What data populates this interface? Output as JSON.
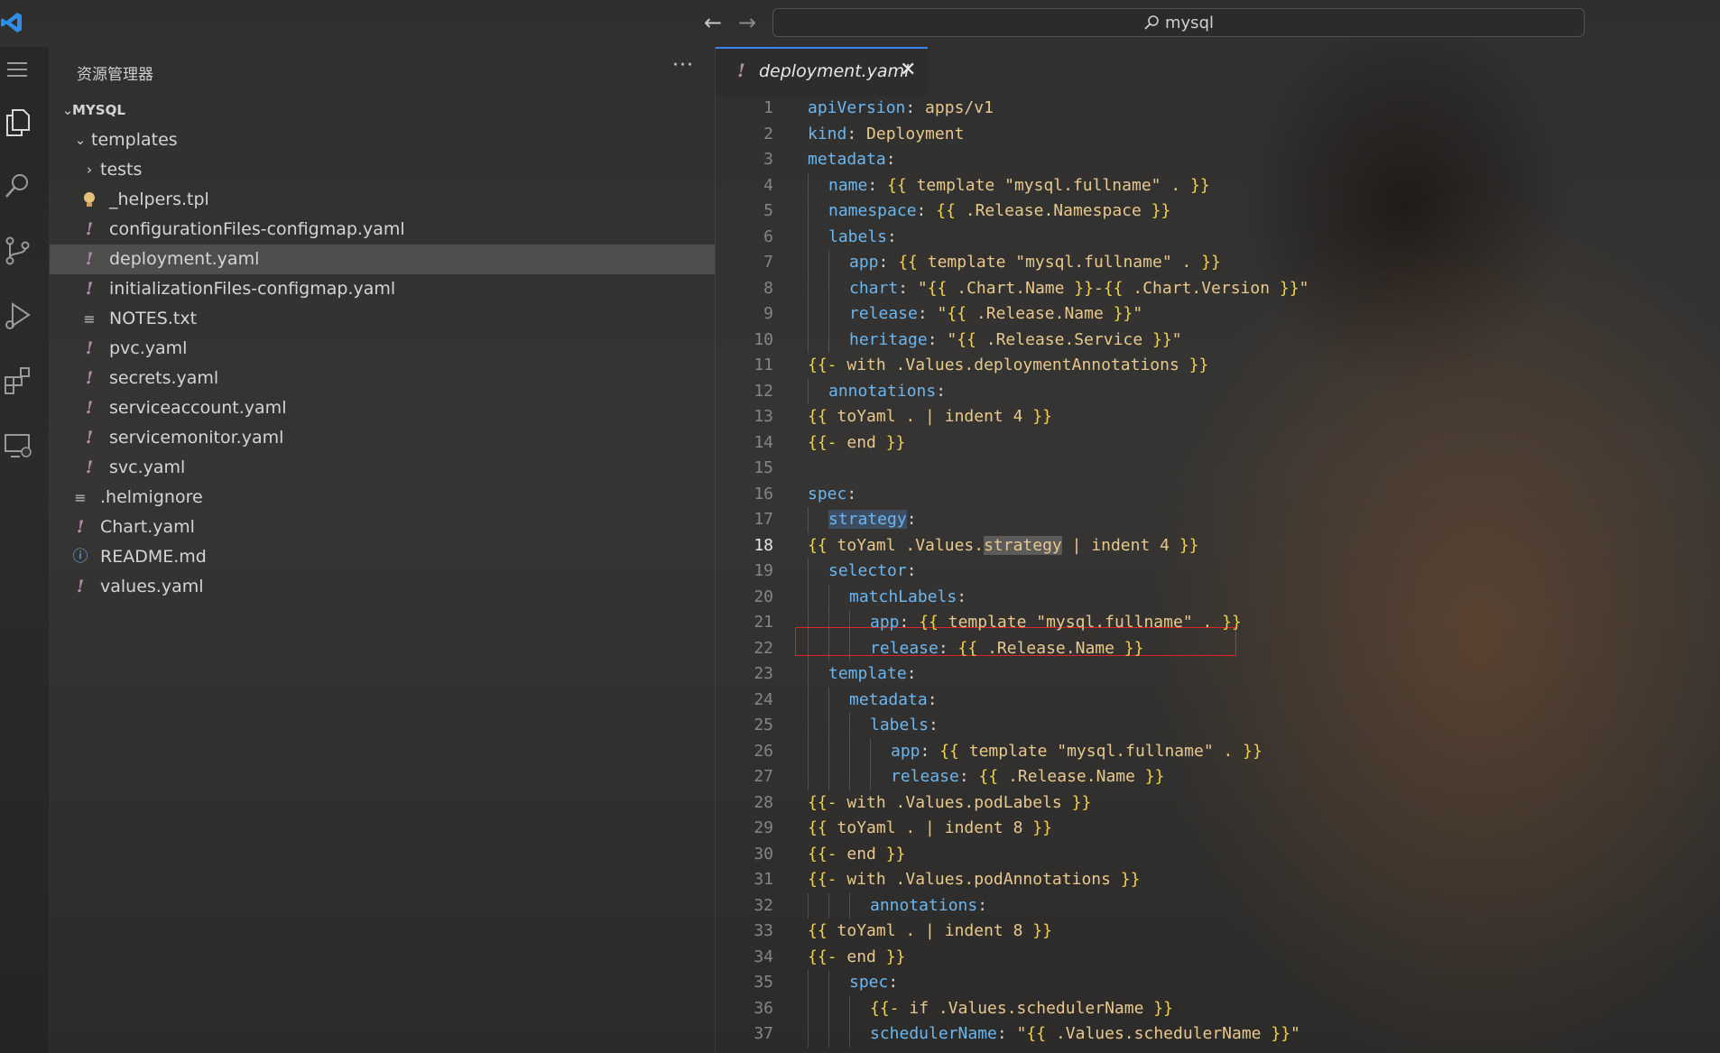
{
  "titlebar": {
    "back_label": "←",
    "forward_label": "→",
    "search_text": "mysql"
  },
  "sidebar": {
    "title": "资源管理器",
    "more_label": "···",
    "tree": [
      {
        "label": "MYSQL",
        "kind": "root",
        "depth": 0
      },
      {
        "label": "templates",
        "kind": "folder-open",
        "depth": 1
      },
      {
        "label": "tests",
        "kind": "folder-closed",
        "depth": 2
      },
      {
        "label": "_helpers.tpl",
        "kind": "tpl",
        "depth": 2
      },
      {
        "label": "configurationFiles-configmap.yaml",
        "kind": "yaml",
        "depth": 2
      },
      {
        "label": "deployment.yaml",
        "kind": "yaml",
        "depth": 2,
        "selected": true
      },
      {
        "label": "initializationFiles-configmap.yaml",
        "kind": "yaml",
        "depth": 2
      },
      {
        "label": "NOTES.txt",
        "kind": "txt",
        "depth": 2
      },
      {
        "label": "pvc.yaml",
        "kind": "yaml",
        "depth": 2
      },
      {
        "label": "secrets.yaml",
        "kind": "yaml",
        "depth": 2
      },
      {
        "label": "serviceaccount.yaml",
        "kind": "yaml",
        "depth": 2
      },
      {
        "label": "servicemonitor.yaml",
        "kind": "yaml",
        "depth": 2
      },
      {
        "label": "svc.yaml",
        "kind": "yaml",
        "depth": 2
      },
      {
        "label": ".helmignore",
        "kind": "txt",
        "depth": 1
      },
      {
        "label": "Chart.yaml",
        "kind": "yaml",
        "depth": 1
      },
      {
        "label": "README.md",
        "kind": "info",
        "depth": 1
      },
      {
        "label": "values.yaml",
        "kind": "yaml",
        "depth": 1
      }
    ]
  },
  "editor": {
    "tab_label": "deployment.yaml",
    "tab_icon": "!",
    "close_label": "✕",
    "current_line": 18,
    "lines": [
      {
        "n": "1",
        "indent": 0,
        "key": "apiVersion",
        "rest": " apps/v1",
        "tpl": false
      },
      {
        "n": "2",
        "indent": 0,
        "key": "kind",
        "rest": " Deployment",
        "tpl": false
      },
      {
        "n": "3",
        "indent": 0,
        "key": "metadata",
        "rest": "",
        "tpl": false
      },
      {
        "n": "4",
        "indent": 1,
        "key": "name",
        "rest": " {{ template \"mysql.fullname\" . }}",
        "tpl": false
      },
      {
        "n": "5",
        "indent": 1,
        "key": "namespace",
        "rest": " {{ .Release.Namespace }}",
        "tpl": false
      },
      {
        "n": "6",
        "indent": 1,
        "key": "labels",
        "rest": "",
        "tpl": false
      },
      {
        "n": "7",
        "indent": 2,
        "key": "app",
        "rest": " {{ template \"mysql.fullname\" . }}",
        "tpl": false
      },
      {
        "n": "8",
        "indent": 2,
        "key": "chart",
        "rest": " \"{{ .Chart.Name }}-{{ .Chart.Version }}\"",
        "tpl": false
      },
      {
        "n": "9",
        "indent": 2,
        "key": "release",
        "rest": " \"{{ .Release.Name }}\"",
        "tpl": false
      },
      {
        "n": "10",
        "indent": 2,
        "key": "heritage",
        "rest": " \"{{ .Release.Service }}\"",
        "tpl": false
      },
      {
        "n": "11",
        "indent": 0,
        "key": "",
        "rest": "{{- with .Values.deploymentAnnotations }}",
        "tpl": true
      },
      {
        "n": "12",
        "indent": 1,
        "key": "annotations",
        "rest": "",
        "tpl": false
      },
      {
        "n": "13",
        "indent": 0,
        "key": "",
        "rest": "{{ toYaml . | indent 4 }}",
        "tpl": true
      },
      {
        "n": "14",
        "indent": 0,
        "key": "",
        "rest": "{{- end }}",
        "tpl": true
      },
      {
        "n": "15",
        "indent": 0,
        "key": "",
        "rest": "",
        "tpl": true
      },
      {
        "n": "16",
        "indent": 0,
        "key": "spec",
        "rest": "",
        "tpl": false
      },
      {
        "n": "17",
        "indent": 1,
        "key": "strategy",
        "rest": "",
        "tpl": false,
        "keyhl": true
      },
      {
        "n": "18",
        "indent": 0,
        "key": "",
        "rest": "{{ toYaml .Values.strategy | indent 4 }}",
        "tpl": true,
        "hlword": "strategy"
      },
      {
        "n": "19",
        "indent": 1,
        "key": "selector",
        "rest": "",
        "tpl": false
      },
      {
        "n": "20",
        "indent": 2,
        "key": "matchLabels",
        "rest": "",
        "tpl": false
      },
      {
        "n": "21",
        "indent": 3,
        "key": "app",
        "rest": " {{ template \"mysql.fullname\" . }}",
        "tpl": false
      },
      {
        "n": "22",
        "indent": 3,
        "key": "release",
        "rest": " {{ .Release.Name }}",
        "tpl": false
      },
      {
        "n": "23",
        "indent": 1,
        "key": "template",
        "rest": "",
        "tpl": false
      },
      {
        "n": "24",
        "indent": 2,
        "key": "metadata",
        "rest": "",
        "tpl": false
      },
      {
        "n": "25",
        "indent": 3,
        "key": "labels",
        "rest": "",
        "tpl": false
      },
      {
        "n": "26",
        "indent": 4,
        "key": "app",
        "rest": " {{ template \"mysql.fullname\" . }}",
        "tpl": false
      },
      {
        "n": "27",
        "indent": 4,
        "key": "release",
        "rest": " {{ .Release.Name }}",
        "tpl": false
      },
      {
        "n": "28",
        "indent": 0,
        "key": "",
        "rest": "{{- with .Values.podLabels }}",
        "tpl": true
      },
      {
        "n": "29",
        "indent": 0,
        "key": "",
        "rest": "{{ toYaml . | indent 8 }}",
        "tpl": true
      },
      {
        "n": "30",
        "indent": 0,
        "key": "",
        "rest": "{{- end }}",
        "tpl": true
      },
      {
        "n": "31",
        "indent": 0,
        "key": "",
        "rest": "{{- with .Values.podAnnotations }}",
        "tpl": true
      },
      {
        "n": "32",
        "indent": 3,
        "key": "annotations",
        "rest": "",
        "tpl": false
      },
      {
        "n": "33",
        "indent": 0,
        "key": "",
        "rest": "{{ toYaml . | indent 8 }}",
        "tpl": true
      },
      {
        "n": "34",
        "indent": 0,
        "key": "",
        "rest": "{{- end }}",
        "tpl": true
      },
      {
        "n": "35",
        "indent": 2,
        "key": "spec",
        "rest": "",
        "tpl": false
      },
      {
        "n": "36",
        "indent": 3,
        "key": "",
        "rest": "{{- if .Values.schedulerName }}",
        "tpl": true
      },
      {
        "n": "37",
        "indent": 3,
        "key": "schedulerName",
        "rest": " \"{{ .Values.schedulerName }}\"",
        "tpl": false
      }
    ]
  },
  "colors": {
    "accent": "#3b82f6",
    "highlight_box": "#e02424",
    "yaml_icon": "#b48ead",
    "key": "#6cb6f0",
    "string": "#e8c88c",
    "brace": "#f2d04b"
  }
}
